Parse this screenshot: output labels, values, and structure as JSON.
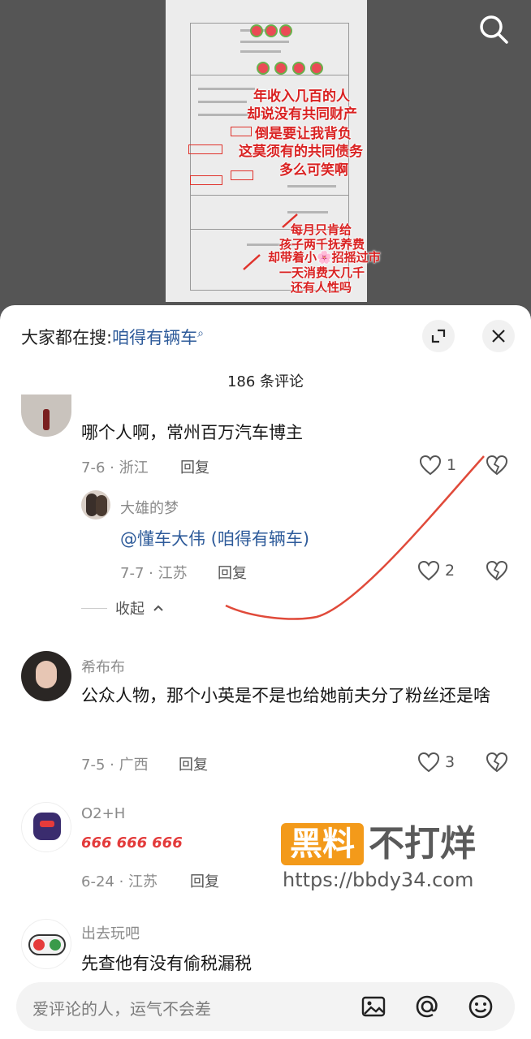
{
  "video": {
    "overlay_text": [
      "年收入几百的人",
      "却说没有共同财产",
      "倒是要让我背负",
      "这莫须有的共同债务",
      "多么可笑啊"
    ],
    "overlay_text_2": [
      "每月只肯给",
      "孩子两千抚养费",
      "却带着小🌸招摇过市",
      "一天消费大几千",
      "还有人性吗"
    ]
  },
  "top": {
    "search_prefix": "大家都在搜:",
    "search_query": "咱得有辆车",
    "comment_count": "186 条评论"
  },
  "comments": [
    {
      "text": "哪个人啊，常州百万汽车博主",
      "meta": "7-6 · 浙江",
      "reply": "回复",
      "likes": "1"
    },
    {
      "name": "大雄的梦",
      "text": "@懂车大伟 (咱得有辆车)",
      "meta": "7-7 · 江苏",
      "reply": "回复",
      "likes": "2",
      "collapse": "收起"
    },
    {
      "name": "希布布",
      "text": "公众人物，那个小英是不是也给她前夫分了粉丝还是啥",
      "meta": "7-5 · 广西",
      "reply": "回复",
      "likes": "3"
    },
    {
      "name": "O2+H",
      "emoji": [
        "666",
        "666",
        "666"
      ],
      "meta": "6-24 · 江苏",
      "reply": "回复"
    },
    {
      "name": "出去玩吧",
      "text": "先查他有没有偷税漏税"
    }
  ],
  "input": {
    "placeholder": "爱评论的人，运气不会差"
  },
  "watermark": {
    "box": "黑料",
    "big": "不打烊",
    "url": "https://bbdy34.com"
  },
  "colors": {
    "link": "#2e5b9a",
    "accent_red": "#d92222",
    "watermark_orange": "#f39a1a"
  }
}
